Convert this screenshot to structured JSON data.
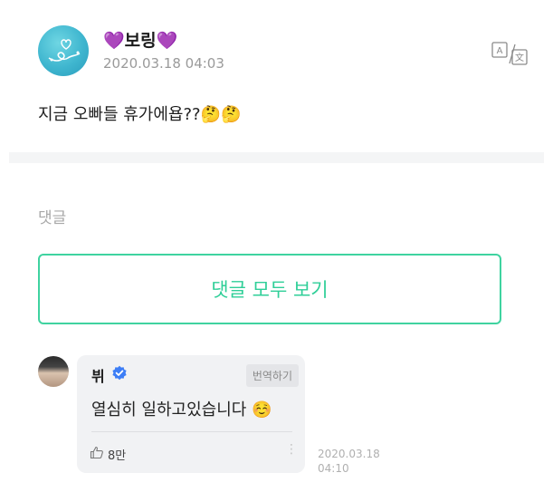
{
  "post": {
    "author": "💜보링💜",
    "date": "2020.03.18 04:03",
    "body": "지금 오빠들 휴가에욥??🤔🤔",
    "translate_icon": "translate-icon"
  },
  "comments": {
    "section_title": "댓글",
    "view_all_label": "댓글 모두 보기",
    "items": [
      {
        "author": "뷔",
        "verified": true,
        "translate_label": "번역하기",
        "text": "열심히 일하고있습니다 ☺️",
        "likes": "8만",
        "more": "⋮",
        "date": "2020.03.18 04:10"
      }
    ]
  },
  "colors": {
    "accent": "#2fcf98",
    "verified": "#3d7ef6"
  }
}
